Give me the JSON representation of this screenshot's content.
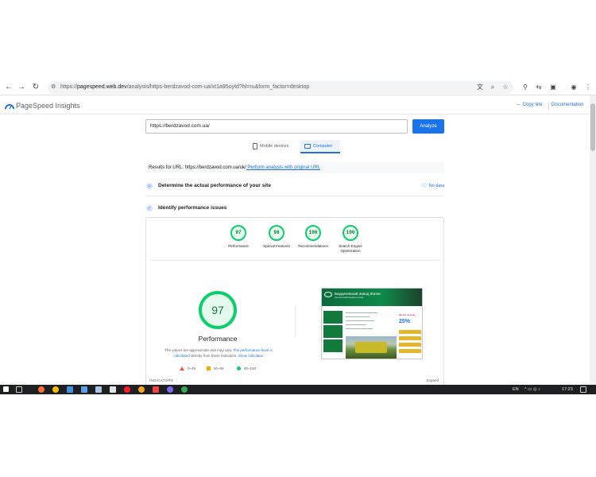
{
  "browser": {
    "url_host": "pagespeed.web.dev",
    "url_path": "/analysis/https-berdzavod-com-ua/xt1a95oytd?hl=ru&form_factor=desktop"
  },
  "app": {
    "title": "PageSpeed Insights",
    "copy_link": "Copy link",
    "documentation": "Documentation"
  },
  "search": {
    "value": "https://berdzavod.com.ua/",
    "analyze_label": "Analyze"
  },
  "tabs": [
    {
      "label": "Mobile devices",
      "selected": false
    },
    {
      "label": "Computer",
      "selected": true
    }
  ],
  "results": {
    "prefix": "Results for URL:",
    "url": "https://berdzavod.com.ua/uk/",
    "link": " Perform analysis with original URL"
  },
  "sections": {
    "real_perf": "Determine the actual performance of your site",
    "no_data": "No data",
    "issues": "Identify performance issues"
  },
  "scores": [
    {
      "value": "97",
      "label": "Performance"
    },
    {
      "value": "98",
      "label": "Special Features"
    },
    {
      "value": "100",
      "label": "Recommendations"
    },
    {
      "value": "100",
      "label": "Search Engine Optimization"
    }
  ],
  "performance": {
    "score": "97",
    "label": "Performance",
    "note_text": "The values are approximate and may vary.",
    "note_link1": " The performance level is calculated",
    "note_mid": " directly from these indicators.",
    "note_link2": " Show calculator"
  },
  "legend": [
    {
      "range": "0–49",
      "color": "#ff4e42"
    },
    {
      "range": "50–89",
      "color": "#ffa400"
    },
    {
      "range": "90–100",
      "color": "#0cce6b"
    }
  ],
  "indicators_label": "INDICATORS",
  "expand_label": "Expand",
  "site_shot": {
    "title": "Бердичевский Завод Жатки",
    "subtitle": "Сельскохозяйственная техника",
    "percent": "25%",
    "discount": "Дисконт на жатки"
  },
  "taskbar": {
    "lang": "EN",
    "time": "17:23"
  },
  "colors": {
    "accent": "#1a73e8",
    "good": "#0cce6b"
  }
}
